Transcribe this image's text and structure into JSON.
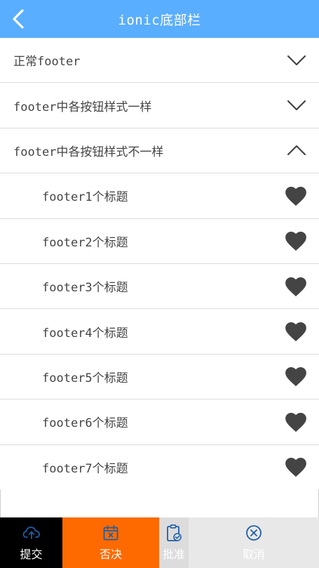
{
  "header": {
    "title": "ionic底部栏",
    "back_icon": "chevron-left-icon"
  },
  "sections": [
    {
      "label": "正常footer",
      "state": "collapsed",
      "icon": "chevron-down-icon"
    },
    {
      "label": "footer中各按钮样式一样",
      "state": "collapsed",
      "icon": "chevron-down-icon"
    },
    {
      "label": "footer中各按钮样式不一样",
      "state": "expanded",
      "icon": "chevron-up-icon"
    }
  ],
  "items": [
    {
      "label": "footer1个标题",
      "icon": "heart-icon"
    },
    {
      "label": "footer2个标题",
      "icon": "heart-icon"
    },
    {
      "label": "footer3个标题",
      "icon": "heart-icon"
    },
    {
      "label": "footer4个标题",
      "icon": "heart-icon"
    },
    {
      "label": "footer5个标题",
      "icon": "heart-icon"
    },
    {
      "label": "footer6个标题",
      "icon": "heart-icon"
    },
    {
      "label": "footer7个标题",
      "icon": "heart-icon"
    }
  ],
  "footer": {
    "submit": {
      "label": "提交",
      "icon": "cloud-upload-icon"
    },
    "reject": {
      "label": "否决",
      "icon": "calendar-x-icon"
    },
    "approve": {
      "label": "批准",
      "icon": "clipboard-check-icon"
    },
    "cancel": {
      "label": "取消",
      "icon": "circle-x-icon"
    }
  },
  "colors": {
    "header_bg": "#5aaeff",
    "submit_bg": "#000000",
    "reject_bg": "#ff6a00",
    "approve_bg": "#dcdcdc",
    "cancel_bg": "#e8e8e8",
    "icon_blue": "#1e5fa8",
    "heart": "#444444"
  }
}
